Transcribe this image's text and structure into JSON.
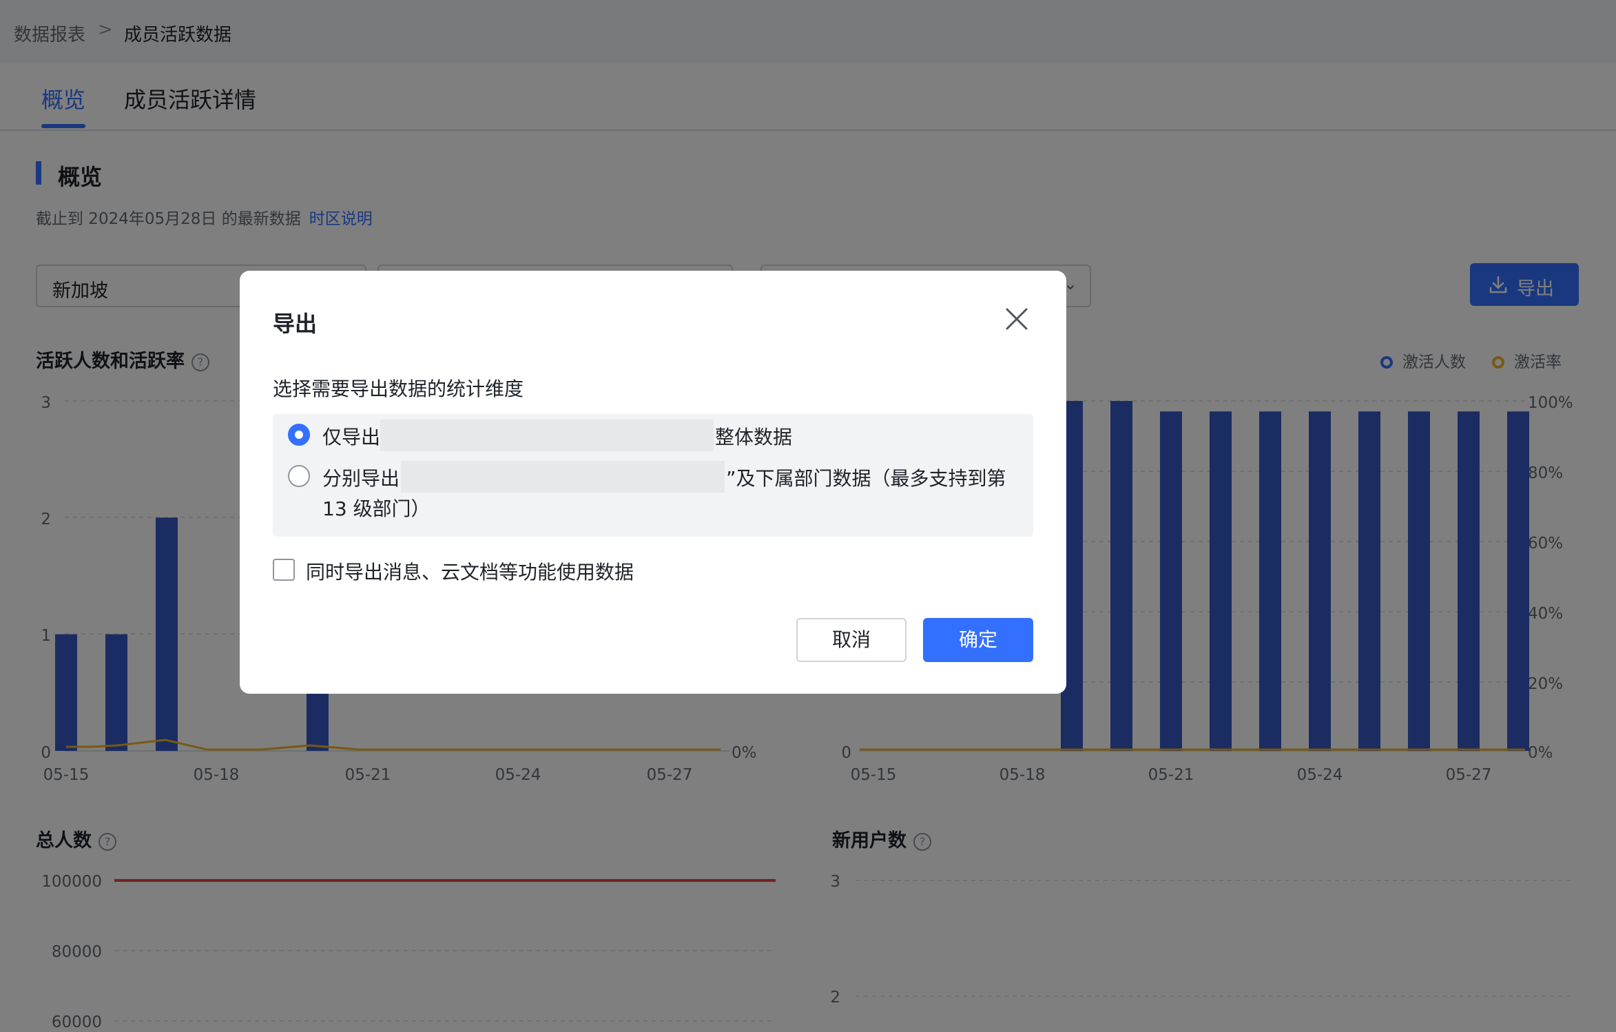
{
  "colors": {
    "accent": "#3370ff",
    "bar": "#3659c4",
    "rate_line": "#f0b323",
    "total_line": "#e54545",
    "grid": "#dee0e3"
  },
  "breadcrumb": {
    "parent": "数据报表",
    "separator": ">",
    "current": "成员活跃数据"
  },
  "tabs": [
    {
      "label": "概览",
      "active": true
    },
    {
      "label": "成员活跃详情",
      "active": false
    }
  ],
  "section": {
    "title": "概览",
    "subtitle": "截止到 2024年05月28日 的最新数据",
    "tz_link": "时区说明"
  },
  "filters": [
    {
      "value": "新加坡"
    },
    {
      "value": ""
    },
    {
      "value": ""
    }
  ],
  "export_button": {
    "label": "导出",
    "icon": "download-icon"
  },
  "legend": [
    {
      "name": "激活人数",
      "color": "#3370ff"
    },
    {
      "name": "激活率",
      "color": "#f0b323"
    }
  ],
  "cards": {
    "active": "活跃人数和活跃率",
    "total": "总人数",
    "new_users": "新用户数"
  },
  "chart_data": [
    {
      "type": "bar",
      "title": "活跃人数和活跃率",
      "x_ticks": [
        "05-15",
        "05-18",
        "05-21",
        "05-24",
        "05-27"
      ],
      "x_range": [
        "05-15",
        "05-28"
      ],
      "y_ticks": [
        "0",
        "1",
        "2",
        "3"
      ],
      "y_right_ticks": [
        "0%"
      ],
      "ylim": [
        0,
        3
      ],
      "series": [
        {
          "type": "bar",
          "values": [
            {
              "x": "05-15",
              "y": 1
            },
            {
              "x": "05-16",
              "y": 1
            },
            {
              "x": "05-17",
              "y": 2
            },
            {
              "x": "05-20",
              "y": 1
            }
          ]
        }
      ],
      "grid": true
    },
    {
      "type": "bar",
      "x_ticks": [
        "05-15",
        "05-18",
        "05-21",
        "05-24",
        "05-27"
      ],
      "x_range": [
        "05-15",
        "05-28"
      ],
      "y_ticks": [
        "0"
      ],
      "y_right_ticks": [
        "0%",
        "20%",
        "40%",
        "60%",
        "80%",
        "100%"
      ],
      "series": [
        {
          "name": "激活人数",
          "type": "bar",
          "values": [
            {
              "x": "05-19",
              "y": 100
            },
            {
              "x": "05-20",
              "y": 100
            },
            {
              "x": "05-21",
              "y": 97
            },
            {
              "x": "05-22",
              "y": 97
            },
            {
              "x": "05-23",
              "y": 97
            },
            {
              "x": "05-24",
              "y": 97
            },
            {
              "x": "05-25",
              "y": 97
            },
            {
              "x": "05-26",
              "y": 97
            },
            {
              "x": "05-27",
              "y": 97
            },
            {
              "x": "05-28",
              "y": 97
            }
          ]
        },
        {
          "name": "激活率",
          "type": "line",
          "values": [
            {
              "x": "05-15",
              "y": 0
            },
            {
              "x": "05-28",
              "y": 0
            }
          ]
        }
      ],
      "legend_position": "top-right",
      "grid": true
    },
    {
      "type": "line",
      "title": "总人数",
      "y_ticks": [
        "60000",
        "80000",
        "100000"
      ],
      "series": [
        {
          "type": "line",
          "values": [
            {
              "x": "05-15",
              "y": 100000
            },
            {
              "x": "05-28",
              "y": 100000
            }
          ]
        }
      ],
      "grid": true
    },
    {
      "type": "line",
      "title": "新用户数",
      "y_ticks": [
        "2",
        "3"
      ],
      "grid": true
    }
  ],
  "dialog": {
    "title": "导出",
    "description": "选择需要导出数据的统计维度",
    "option1": {
      "prefix": "仅导出",
      "suffix": "整体数据",
      "selected": true
    },
    "option2": {
      "prefix": "分别导出",
      "suffix": "”及下属部门数据（最多支持到第",
      "line2": "13 级部门）",
      "selected": false
    },
    "checkbox": {
      "label": "同时导出消息、云文档等功能使用数据",
      "checked": false
    },
    "cancel": "取消",
    "confirm": "确定"
  }
}
